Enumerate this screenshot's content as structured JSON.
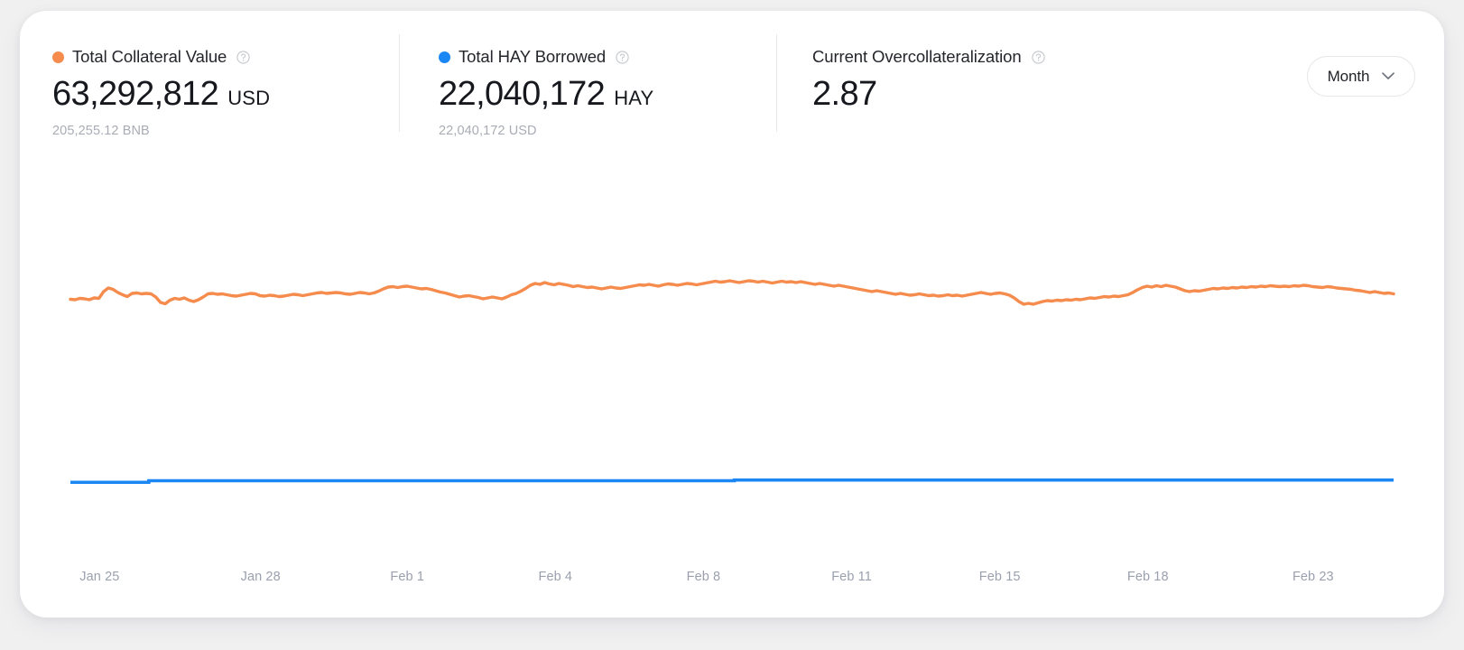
{
  "metrics": [
    {
      "title": "Total Collateral Value",
      "dot_color": "#f58b4c",
      "dot_name": "orange",
      "value": "63,292,812",
      "unit": "USD",
      "sub": "205,255.12 BNB",
      "help_icon": "help-circle-icon"
    },
    {
      "title": "Total HAY Borrowed",
      "dot_color": "#1b87f5",
      "dot_name": "blue",
      "value": "22,040,172",
      "unit": "HAY",
      "sub": "22,040,172 USD",
      "help_icon": "help-circle-icon"
    },
    {
      "title": "Current Overcollateralization",
      "dot_color": null,
      "dot_name": null,
      "value": "2.87",
      "unit": "",
      "sub": "",
      "help_icon": "help-circle-icon"
    }
  ],
  "period_select": {
    "label": "Month",
    "chevron_icon": "chevron-down-icon"
  },
  "chart_data": {
    "type": "line",
    "title": "",
    "xlabel": "",
    "ylabel": "",
    "grid": false,
    "legend": [
      "Total Collateral Value",
      "Total HAY Borrowed"
    ],
    "legend_position": "top",
    "x_tick_labels": [
      "Jan 25",
      "Jan 28",
      "Feb 1",
      "Feb 4",
      "Feb 8",
      "Feb 11",
      "Feb 15",
      "Feb 18",
      "Feb 23"
    ],
    "x_tick_positions_pct": [
      5.6,
      16.9,
      27.2,
      37.6,
      48.0,
      58.4,
      68.8,
      79.2,
      90.8
    ],
    "series": [
      {
        "name": "Total Collateral Value",
        "color": "#f58b4c",
        "unit": "USD",
        "values": [
          62.1,
          62.0,
          62.3,
          62.2,
          62.0,
          62.4,
          62.3,
          63.8,
          64.6,
          64.3,
          63.6,
          63.1,
          62.7,
          63.4,
          63.5,
          63.3,
          63.4,
          63.3,
          62.6,
          61.4,
          61.1,
          61.9,
          62.3,
          62.1,
          62.4,
          61.9,
          61.6,
          62.0,
          62.6,
          63.3,
          63.4,
          63.2,
          63.3,
          63.1,
          62.9,
          62.8,
          63.0,
          63.2,
          63.4,
          63.3,
          62.9,
          62.8,
          63.0,
          62.9,
          62.7,
          62.8,
          63.0,
          63.2,
          63.1,
          62.9,
          63.1,
          63.3,
          63.5,
          63.6,
          63.4,
          63.5,
          63.6,
          63.5,
          63.3,
          63.2,
          63.4,
          63.6,
          63.5,
          63.3,
          63.5,
          63.9,
          64.4,
          64.8,
          64.9,
          64.7,
          64.9,
          65.0,
          64.8,
          64.6,
          64.4,
          64.5,
          64.3,
          64.0,
          63.7,
          63.5,
          63.2,
          62.9,
          62.6,
          62.8,
          62.9,
          62.7,
          62.5,
          62.2,
          62.4,
          62.6,
          62.4,
          62.2,
          62.6,
          63.1,
          63.4,
          63.9,
          64.5,
          65.2,
          65.6,
          65.4,
          65.8,
          65.5,
          65.3,
          65.6,
          65.4,
          65.2,
          64.9,
          65.1,
          64.9,
          64.7,
          64.8,
          64.6,
          64.4,
          64.6,
          64.8,
          64.6,
          64.5,
          64.7,
          64.9,
          65.1,
          65.3,
          65.2,
          65.4,
          65.2,
          65.0,
          65.3,
          65.5,
          65.4,
          65.2,
          65.4,
          65.6,
          65.5,
          65.3,
          65.5,
          65.7,
          65.9,
          66.1,
          65.9,
          66.0,
          66.2,
          66.0,
          65.8,
          66.0,
          66.2,
          66.1,
          65.9,
          66.1,
          65.9,
          65.7,
          65.9,
          66.1,
          65.9,
          66.0,
          65.8,
          66.0,
          65.8,
          65.6,
          65.4,
          65.6,
          65.4,
          65.2,
          65.0,
          65.2,
          65.0,
          64.8,
          64.6,
          64.4,
          64.2,
          64.0,
          63.8,
          64.0,
          63.8,
          63.6,
          63.4,
          63.2,
          63.4,
          63.2,
          63.0,
          63.1,
          63.3,
          63.1,
          62.9,
          63.0,
          62.8,
          62.9,
          63.1,
          62.9,
          63.0,
          62.8,
          63.0,
          63.2,
          63.4,
          63.6,
          63.4,
          63.2,
          63.4,
          63.5,
          63.3,
          63.0,
          62.4,
          61.6,
          61.0,
          61.2,
          61.0,
          61.3,
          61.6,
          61.8,
          61.7,
          61.9,
          61.8,
          62.0,
          61.9,
          62.1,
          62.0,
          62.2,
          62.4,
          62.3,
          62.5,
          62.7,
          62.6,
          62.8,
          62.7,
          62.9,
          63.1,
          63.6,
          64.2,
          64.7,
          65.0,
          64.8,
          65.1,
          64.9,
          65.2,
          65.0,
          64.8,
          64.4,
          64.0,
          63.8,
          64.0,
          63.9,
          64.1,
          64.3,
          64.5,
          64.4,
          64.6,
          64.5,
          64.7,
          64.6,
          64.8,
          64.7,
          64.9,
          64.8,
          65.0,
          64.9,
          65.1,
          65.0,
          64.9,
          65.0,
          64.9,
          65.1,
          65.0,
          65.2,
          65.1,
          64.9,
          64.8,
          64.7,
          64.9,
          64.8,
          64.6,
          64.5,
          64.4,
          64.3,
          64.1,
          64.0,
          63.8,
          63.6,
          63.8,
          63.6,
          63.4,
          63.5,
          63.3
        ]
      },
      {
        "name": "Total HAY Borrowed",
        "color": "#1b87f5",
        "unit": "HAY",
        "values": [
          21.55,
          21.55,
          21.55,
          21.55,
          21.55,
          21.55,
          21.55,
          21.55,
          21.55,
          21.55,
          21.55,
          21.55,
          21.55,
          21.55,
          21.55,
          21.55,
          21.55,
          21.9,
          21.9,
          21.9,
          21.9,
          21.9,
          21.9,
          21.9,
          21.9,
          21.9,
          21.9,
          21.9,
          21.9,
          21.9,
          21.9,
          21.9,
          21.9,
          21.9,
          21.9,
          21.9,
          21.9,
          21.9,
          21.9,
          21.9,
          21.9,
          21.9,
          21.9,
          21.9,
          21.9,
          21.9,
          21.9,
          21.9,
          21.9,
          21.9,
          21.9,
          21.9,
          21.9,
          21.9,
          21.9,
          21.9,
          21.9,
          21.9,
          21.9,
          21.9,
          21.9,
          21.9,
          21.9,
          21.9,
          21.9,
          21.9,
          21.9,
          21.9,
          21.9,
          21.9,
          21.9,
          21.9,
          21.9,
          21.9,
          21.9,
          21.9,
          21.9,
          21.9,
          21.9,
          21.9,
          21.9,
          21.9,
          21.9,
          21.9,
          21.9,
          21.9,
          21.9,
          21.9,
          21.9,
          21.9,
          21.9,
          21.9,
          21.9,
          21.9,
          21.9,
          21.9,
          21.9,
          21.9,
          21.9,
          21.9,
          21.9,
          21.9,
          21.9,
          21.9,
          21.9,
          21.9,
          21.9,
          21.9,
          21.9,
          21.9,
          21.9,
          21.9,
          21.9,
          21.9,
          21.9,
          21.9,
          21.9,
          21.9,
          21.9,
          21.9,
          21.9,
          21.9,
          21.9,
          21.9,
          21.9,
          21.9,
          21.9,
          21.9,
          21.9,
          21.9,
          21.9,
          21.9,
          21.9,
          21.9,
          21.9,
          21.9,
          21.9,
          21.9,
          21.9,
          21.9,
          21.9,
          21.9,
          21.9,
          21.9,
          22.05,
          22.05,
          22.05,
          22.05,
          22.05,
          22.05,
          22.05,
          22.05,
          22.05,
          22.05,
          22.05,
          22.05,
          22.05,
          22.05,
          22.05,
          22.05,
          22.05,
          22.05,
          22.05,
          22.05,
          22.05,
          22.05,
          22.05,
          22.05,
          22.05,
          22.05,
          22.05,
          22.05,
          22.05,
          22.05,
          22.05,
          22.05,
          22.05,
          22.05,
          22.05,
          22.05,
          22.05,
          22.05,
          22.05,
          22.05,
          22.05,
          22.05,
          22.05,
          22.05,
          22.05,
          22.05,
          22.05,
          22.05,
          22.05,
          22.05,
          22.05,
          22.05,
          22.05,
          22.05,
          22.05,
          22.05,
          22.05,
          22.05,
          22.05,
          22.05,
          22.05,
          22.05,
          22.05,
          22.05,
          22.05,
          22.05,
          22.05,
          22.05,
          22.05,
          22.05,
          22.05,
          22.05,
          22.05,
          22.05,
          22.05,
          22.05,
          22.05,
          22.05,
          22.05,
          22.05,
          22.05,
          22.05,
          22.05,
          22.05,
          22.05,
          22.05,
          22.05,
          22.05,
          22.05,
          22.05,
          22.05,
          22.05,
          22.05,
          22.05,
          22.05,
          22.05,
          22.05,
          22.05,
          22.05,
          22.05,
          22.05,
          22.05,
          22.05,
          22.05,
          22.05,
          22.05,
          22.05,
          22.05,
          22.05,
          22.05,
          22.05,
          22.05,
          22.05,
          22.05,
          22.05,
          22.05,
          22.05,
          22.05,
          22.05,
          22.05,
          22.05,
          22.05,
          22.05,
          22.05,
          22.05,
          22.05,
          22.05,
          22.05,
          22.05,
          22.05,
          22.05,
          22.05,
          22.05,
          22.05,
          22.05,
          22.05,
          22.05,
          22.05,
          22.05,
          22.05,
          22.05,
          22.05,
          22.05,
          22.05
        ]
      }
    ],
    "ylim": [
      0,
      70
    ]
  }
}
